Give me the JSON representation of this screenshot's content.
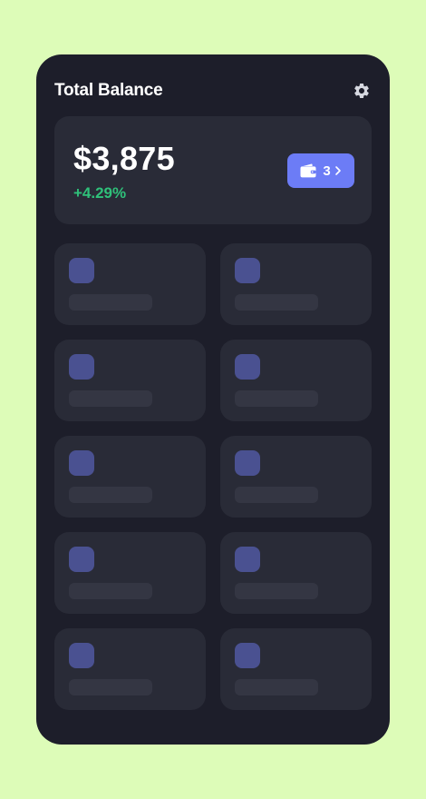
{
  "header": {
    "title": "Total Balance",
    "settings_icon": "gear-icon"
  },
  "balance": {
    "amount": "$3,875",
    "change": "+4.29%",
    "change_color": "#2fc17a"
  },
  "wallet_button": {
    "count": "3",
    "icon": "wallet-icon",
    "chevron": "chevron-right-icon",
    "color": "#6c7cf6"
  },
  "colors": {
    "background": "#ddfcb8",
    "panel": "#1d1e2a",
    "card": "#292b37",
    "placeholder_icon": "#4a5191",
    "placeholder_line": "#343643"
  },
  "tiles_count": 10
}
